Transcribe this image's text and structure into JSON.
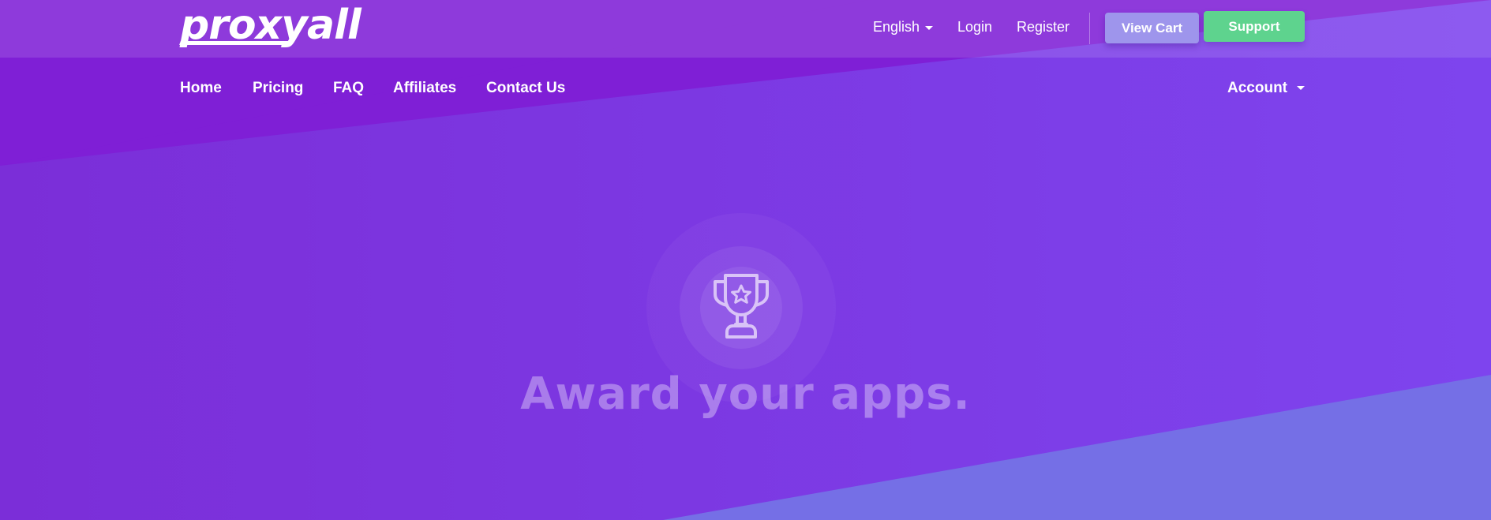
{
  "brand": {
    "logo_text": "proxyall"
  },
  "topbar": {
    "language": "English",
    "login": "Login",
    "register": "Register",
    "view_cart": "View Cart",
    "support": "Support"
  },
  "nav": {
    "items": [
      {
        "label": "Home"
      },
      {
        "label": "Pricing"
      },
      {
        "label": "FAQ"
      },
      {
        "label": "Affiliates"
      },
      {
        "label": "Contact Us"
      }
    ],
    "account": "Account"
  },
  "hero": {
    "icon": "trophy-star-icon",
    "headline": "Award your apps."
  },
  "colors": {
    "background": "#7C31E0",
    "accent_dark": "#7F1FD6",
    "accent_light": "#756FE6",
    "view_cart_button": "#9E95EC",
    "support_button": "#5ED38E"
  }
}
